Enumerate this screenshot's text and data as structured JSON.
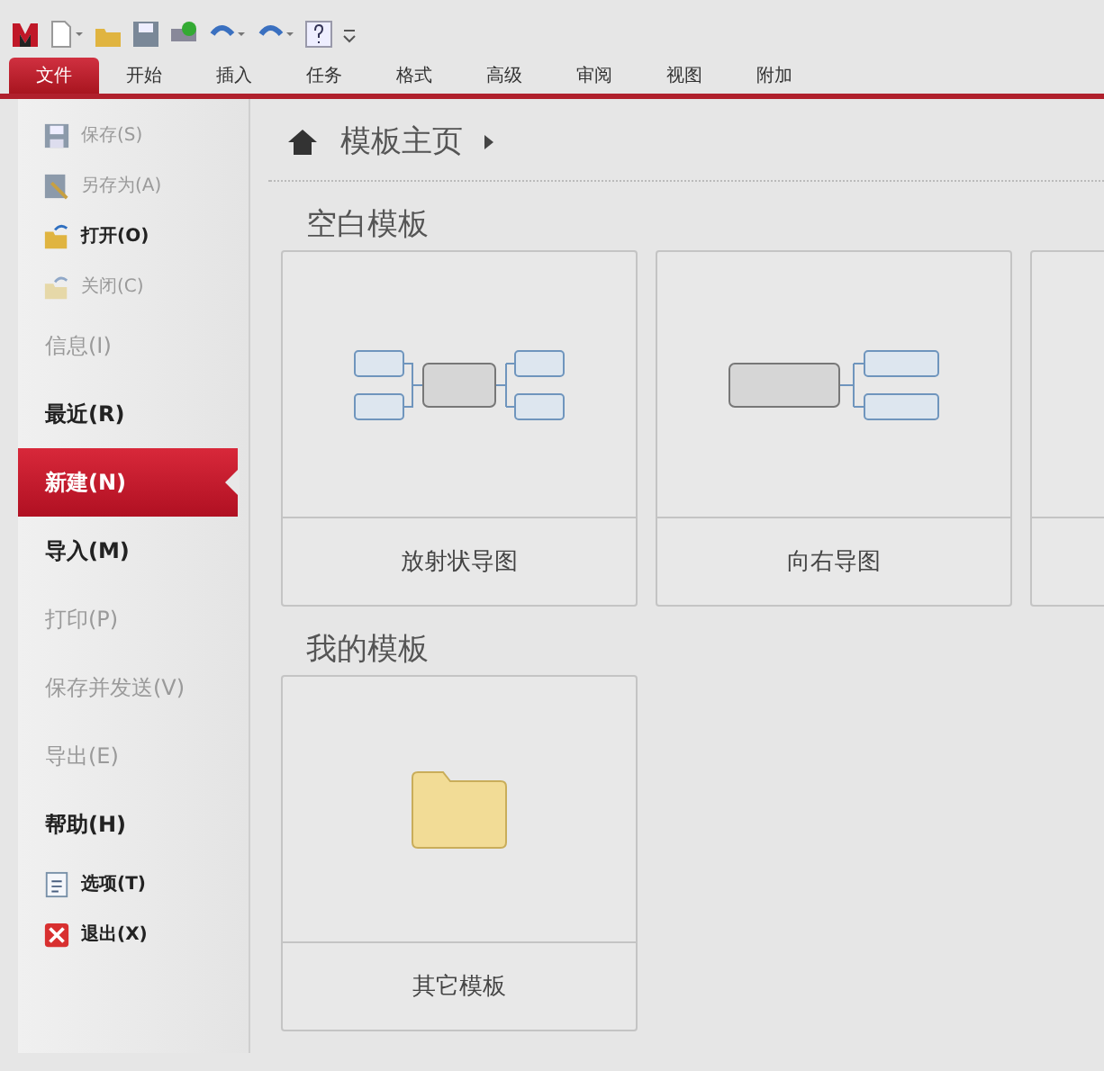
{
  "quick_access": {
    "items": [
      {
        "kind": "logo"
      },
      {
        "kind": "new"
      },
      {
        "kind": "open"
      },
      {
        "kind": "save"
      },
      {
        "kind": "print"
      },
      {
        "kind": "undo"
      },
      {
        "kind": "redo"
      },
      {
        "kind": "help"
      },
      {
        "kind": "more"
      }
    ]
  },
  "tabs": [
    {
      "label": "文件",
      "selected": true
    },
    {
      "label": "开始",
      "selected": false
    },
    {
      "label": "插入",
      "selected": false
    },
    {
      "label": "任务",
      "selected": false
    },
    {
      "label": "格式",
      "selected": false
    },
    {
      "label": "高级",
      "selected": false
    },
    {
      "label": "审阅",
      "selected": false
    },
    {
      "label": "视图",
      "selected": false
    },
    {
      "label": "附加",
      "selected": false
    }
  ],
  "sidebar": {
    "items": [
      {
        "kind": "save",
        "label": "保存(S)",
        "disabled": true,
        "selected": false
      },
      {
        "kind": "saveas",
        "label": "另存为(A)",
        "disabled": true,
        "selected": false
      },
      {
        "kind": "open",
        "label": "打开(O)",
        "disabled": false,
        "selected": false
      },
      {
        "kind": "close",
        "label": "关闭(C)",
        "disabled": true,
        "selected": false
      },
      {
        "kind": "page",
        "label": "信息(I)",
        "disabled": true,
        "selected": false
      },
      {
        "kind": "page",
        "label": "最近(R)",
        "disabled": false,
        "selected": false
      },
      {
        "kind": "page",
        "label": "新建(N)",
        "disabled": false,
        "selected": true
      },
      {
        "kind": "page",
        "label": "导入(M)",
        "disabled": false,
        "selected": false
      },
      {
        "kind": "page",
        "label": "打印(P)",
        "disabled": true,
        "selected": false
      },
      {
        "kind": "page",
        "label": "保存并发送(V)",
        "disabled": true,
        "selected": false
      },
      {
        "kind": "page",
        "label": "导出(E)",
        "disabled": true,
        "selected": false
      },
      {
        "kind": "page",
        "label": "帮助(H)",
        "disabled": false,
        "selected": false
      },
      {
        "kind": "options",
        "label": "选项(T)",
        "disabled": false,
        "selected": false
      },
      {
        "kind": "exit",
        "label": "退出(X)",
        "disabled": false,
        "selected": false
      }
    ]
  },
  "breadcrumb": {
    "title": "模板主页"
  },
  "sections": [
    {
      "title": "空白模板",
      "cards": [
        {
          "kind": "radial",
          "label": "放射状导图"
        },
        {
          "kind": "right",
          "label": "向右导图"
        },
        {
          "kind": "cut"
        }
      ]
    },
    {
      "title": "我的模板",
      "cards": [
        {
          "kind": "folder",
          "label": "其它模板"
        }
      ]
    }
  ]
}
